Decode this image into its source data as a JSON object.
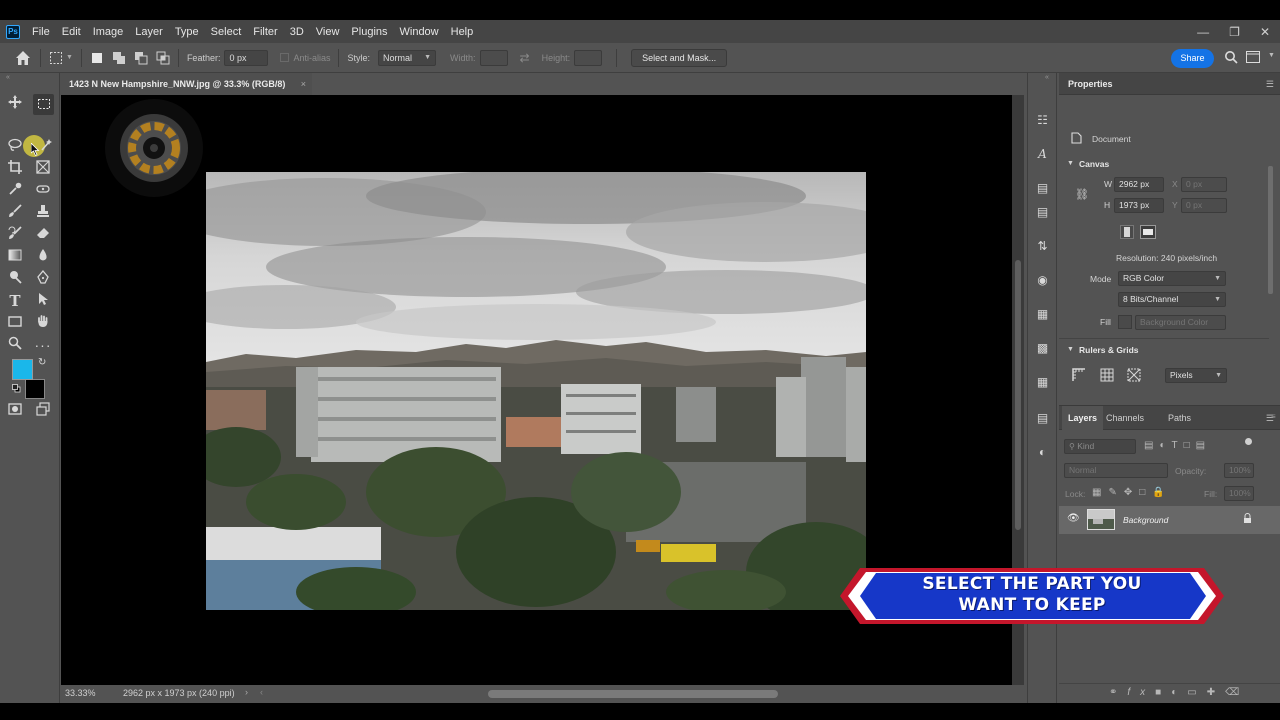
{
  "app": {
    "logo": "Ps",
    "menu": [
      "File",
      "Edit",
      "Image",
      "Layer",
      "Type",
      "Select",
      "Filter",
      "3D",
      "View",
      "Plugins",
      "Window",
      "Help"
    ],
    "window_controls": [
      "minimize-icon",
      "restore-icon",
      "close-icon"
    ]
  },
  "options_bar": {
    "feather_label": "Feather:",
    "feather_value": "0 px",
    "anti_alias_label": "Anti-alias",
    "style_label": "Style:",
    "style_value": "Normal",
    "width_label": "Width:",
    "height_label": "Height:",
    "select_mask_label": "Select and Mask...",
    "share_label": "Share"
  },
  "document": {
    "tab_title": "1423 N New Hampshire_NNW.jpg @ 33.3% (RGB/8)",
    "close_glyph": "×",
    "zoom": "33.33%",
    "doc_info": "2962 px x 1973 px (240 ppi)"
  },
  "properties": {
    "title": "Properties",
    "doc_label": "Document",
    "canvas_section": "Canvas",
    "w_label": "W",
    "w_value": "2962 px",
    "h_label": "H",
    "h_value": "1973 px",
    "x_label": "X",
    "x_value": "0 px",
    "y_label": "Y",
    "y_value": "0 px",
    "resolution": "Resolution: 240 pixels/inch",
    "mode_label": "Mode",
    "mode_value": "RGB Color",
    "bits_value": "8 Bits/Channel",
    "fill_label": "Fill",
    "fill_value": "Background Color",
    "rulers_section": "Rulers & Grids",
    "units_value": "Pixels"
  },
  "layers_panel": {
    "tabs": [
      "Layers",
      "Channels",
      "Paths"
    ],
    "filter_placeholder": "Kind",
    "blend_mode": "Normal",
    "opacity_label": "Opacity:",
    "opacity_value": "100%",
    "lock_label": "Lock:",
    "fill_label": "Fill:",
    "fill_value": "100%",
    "layer_name": "Background"
  },
  "overlay": {
    "banner_line1": "SELECT THE PART YOU",
    "banner_line2": "WANT TO KEEP",
    "banner_color": "#1637c8",
    "banner_accent": "#c4162b"
  },
  "colors": {
    "foreground": "#1ab7ea",
    "background": "#000000",
    "accent": "#1473e6"
  }
}
